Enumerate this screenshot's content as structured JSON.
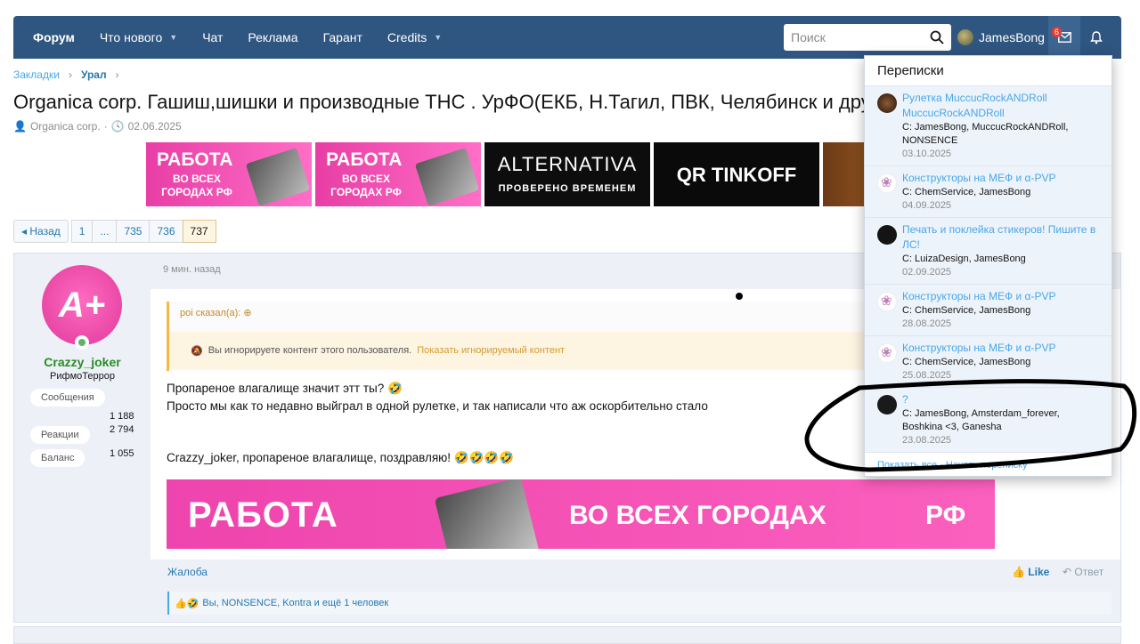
{
  "nav": {
    "items": [
      {
        "label": "Форум",
        "active": true,
        "caret": false
      },
      {
        "label": "Что нового",
        "caret": true
      },
      {
        "label": "Чат",
        "caret": false
      },
      {
        "label": "Реклама",
        "caret": false
      },
      {
        "label": "Гарант",
        "caret": false
      },
      {
        "label": "Credits",
        "caret": true
      }
    ],
    "search_placeholder": "Поиск",
    "username": "JamesBong",
    "mail_badge": "6",
    "colors": {
      "bar": "#2f5680",
      "accent": "#47a7eb"
    }
  },
  "breadcrumb": {
    "root": "Закладки",
    "current": "Урал"
  },
  "thread": {
    "title": "Organica corp. Гашиш,шишки и производные ТНС . УрФО(ЕКБ, Н.Тагил, ПВК, Челябинск и другие",
    "author": "Organica corp.",
    "date": "02.06.2025"
  },
  "banners": {
    "pink_title": "РАБОТА",
    "pink_sub": "ВО ВСЕХ ГОРОДАХ РФ",
    "pink_device": "206",
    "alt_title": "ALTERNATIVA",
    "alt_sub": "ПРОВЕРЕНО ВРЕМЕНЕМ",
    "qr_title": "QR TINKOFF"
  },
  "pagination": {
    "prev": "◂ Назад",
    "pages": [
      "1",
      "...",
      "735",
      "736"
    ],
    "current": "737"
  },
  "post": {
    "time": "9 мин. назад",
    "user": {
      "avatar_text": "A+",
      "name": "Crazzy_joker",
      "title": "РифмоТеррор",
      "stats": [
        {
          "label": "Сообщения",
          "value": "1 188"
        },
        {
          "label": "Реакции",
          "value": "2 794"
        },
        {
          "label": "Баланс",
          "value": "1 055"
        }
      ]
    },
    "quote_header": "poi сказал(а): ⊕",
    "ignored_text": "Вы игнорируете контент этого пользователя.",
    "ignored_link": "Показать игнорируемый контент",
    "line1": "Пропареное влагалище значит этт ты? 🤣",
    "line2": "Просто мы как то недавно выйграл в одной рулетке, и так написали что аж оскорбительно стало",
    "line3": "Crazzy_joker, пропареное влагалище, поздравляю! 🤣🤣🤣🤣",
    "banner_left": "РАБОТА",
    "banner_mid": "ВО ВСЕХ ГОРОДАХ",
    "banner_right": "РФ",
    "report": "Жалоба",
    "like": "Like",
    "reply": "Ответ",
    "reactions": "Вы, NONSENCE, Kontra и ещё 1 человек"
  },
  "dropdown": {
    "header": "Переписки",
    "items": [
      {
        "avatar": "roulette",
        "title": "Рулетка MuccucRockANDRoll MuccucRockANDRoll",
        "people": "С: JamesBong, MuccucRockANDRoll, NONSENCE",
        "date": "03.10.2025"
      },
      {
        "avatar": "chem",
        "title": "Конструкторы на МЕФ и α-PVP",
        "people": "С: ChemService, JamesBong",
        "date": "04.09.2025"
      },
      {
        "avatar": "print",
        "title": "Печать и поклейка стикеров! Пишите в ЛС!",
        "people": "С: LuizaDesign, JamesBong",
        "date": "02.09.2025"
      },
      {
        "avatar": "chem",
        "title": "Конструкторы на МЕФ и α-PVP",
        "people": "С: ChemService, JamesBong",
        "date": "28.08.2025"
      },
      {
        "avatar": "chem",
        "title": "Конструкторы на МЕФ и α-PVP",
        "people": "С: ChemService, JamesBong",
        "date": "25.08.2025"
      },
      {
        "avatar": "amsterdam",
        "title": "?",
        "people": "С: JamesBong, Amsterdam_forever, Boshkina <3, Ganesha",
        "date": "23.08.2025"
      }
    ],
    "footer": "Показать все · Начать переписку"
  }
}
